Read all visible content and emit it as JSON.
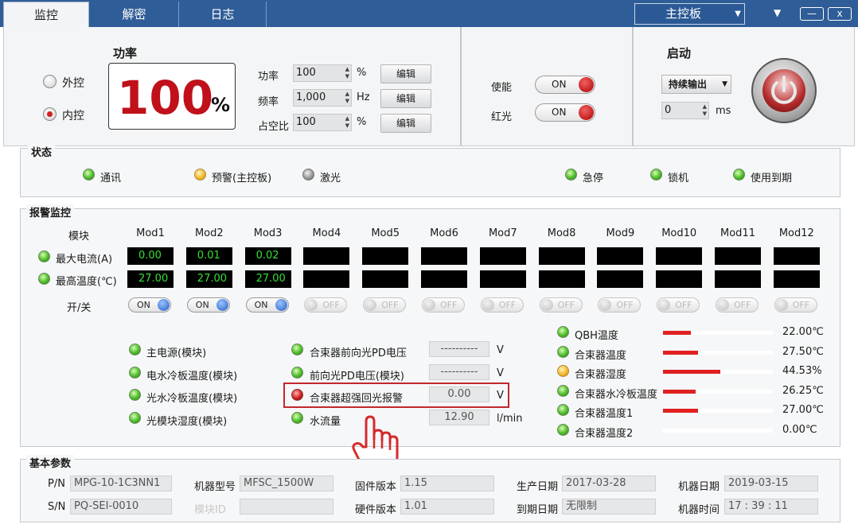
{
  "tabs": [
    "监控",
    "解密",
    "日志"
  ],
  "board_select": "主控板",
  "window": {
    "menu": "▼",
    "minimize": "—",
    "close": "x"
  },
  "power": {
    "title": "功率",
    "mode_external": "外控",
    "mode_internal": "内控",
    "mode_selected": "内控",
    "display_value": "100",
    "display_unit": "%",
    "params": [
      {
        "label": "功率",
        "value": "100",
        "unit": "%",
        "button": "编辑"
      },
      {
        "label": "频率",
        "value": "1,000",
        "unit": "Hz",
        "button": "编辑"
      },
      {
        "label": "占空比",
        "value": "100",
        "unit": "%",
        "button": "编辑"
      }
    ]
  },
  "switches": [
    {
      "label": "使能",
      "state": "ON"
    },
    {
      "label": "红光",
      "state": "ON"
    }
  ],
  "start": {
    "title": "启动",
    "mode": "持续输出",
    "delay_value": "0",
    "delay_unit": "ms",
    "power_icon": "power-icon"
  },
  "status": {
    "title": "状态",
    "items": [
      {
        "label": "通讯",
        "color": "green"
      },
      {
        "label": "预警(主控板)",
        "color": "yellow"
      },
      {
        "label": "激光",
        "color": "gray"
      },
      {
        "label": "急停",
        "color": "green"
      },
      {
        "label": "锁机",
        "color": "green"
      },
      {
        "label": "使用到期",
        "color": "green"
      }
    ]
  },
  "alarm": {
    "title": "报警监控",
    "module_header": "模块",
    "modules": [
      "Mod1",
      "Mod2",
      "Mod3",
      "Mod4",
      "Mod5",
      "Mod6",
      "Mod7",
      "Mod8",
      "Mod9",
      "Mod10",
      "Mod11",
      "Mod12"
    ],
    "row_current": {
      "label": "最大电流(A)",
      "values": [
        "0.00",
        "0.01",
        "0.02",
        "",
        "",
        "",
        "",
        "",
        "",
        "",
        "",
        ""
      ]
    },
    "row_temp": {
      "label": "最高温度(℃)",
      "values": [
        "27.00",
        "27.00",
        "27.00",
        "",
        "",
        "",
        "",
        "",
        "",
        "",
        "",
        ""
      ]
    },
    "row_switch": {
      "label": "开/关",
      "values": [
        "ON",
        "ON",
        "ON",
        "OFF",
        "OFF",
        "OFF",
        "OFF",
        "OFF",
        "OFF",
        "OFF",
        "OFF",
        "OFF"
      ]
    },
    "checks": [
      {
        "label": "主电源(模块)"
      },
      {
        "label": "电水冷板温度(模块)"
      },
      {
        "label": "光水冷板温度(模块)"
      },
      {
        "label": "光模块湿度(模块)"
      }
    ],
    "sensors": [
      {
        "label": "合束器前向光PD电压",
        "value": "----------",
        "unit": "V",
        "led": "green"
      },
      {
        "label": "前向光PD电压(模块)",
        "value": "----------",
        "unit": "V",
        "led": "green"
      },
      {
        "label": "合束器超强回光报警",
        "value": "0.00",
        "unit": "V",
        "led": "red"
      },
      {
        "label": "水流量",
        "value": "12.90",
        "unit": "l/min",
        "led": "green"
      }
    ],
    "gauges": [
      {
        "label": "QBH温度",
        "value": "22.00℃",
        "fill": 0.25,
        "led": "green"
      },
      {
        "label": "合束器温度",
        "value": "27.50℃",
        "fill": 0.32,
        "led": "green"
      },
      {
        "label": "合束器湿度",
        "value": "44.53%",
        "fill": 0.52,
        "led": "yellow"
      },
      {
        "label": "合束器水冷板温度",
        "value": "26.25℃",
        "fill": 0.3,
        "led": "green"
      },
      {
        "label": "合束器温度1",
        "value": "27.00℃",
        "fill": 0.32,
        "led": "green"
      },
      {
        "label": "合束器温度2",
        "value": "0.00℃",
        "fill": 0.0,
        "led": "green"
      }
    ]
  },
  "basic": {
    "title": "基本参数",
    "pn_label": "P/N",
    "pn_value": "MPG-10-1C3NN1",
    "sn_label": "S/N",
    "sn_value": "PQ-SEI-0010",
    "model_label": "机器型号",
    "model_value": "MFSC_1500W",
    "module_id_label": "模块ID",
    "module_id_value": "",
    "fw_label": "固件版本",
    "fw_value": "1.15",
    "hw_label": "硬件版本",
    "hw_value": "1.01",
    "prod_date_label": "生产日期",
    "prod_date_value": "2017-03-28",
    "expire_label": "到期日期",
    "expire_value": "无限制",
    "machine_date_label": "机器日期",
    "machine_date_value": "2019-03-15",
    "machine_time_label": "机器时间",
    "machine_time_value": "17 : 39 : 11"
  },
  "colors": {
    "titlebar": "#2f5d97",
    "alarm_red": "#e02020",
    "lcd_green": "#34e034",
    "highlight_box": "#c0282d",
    "hand": "#d62b2b"
  }
}
